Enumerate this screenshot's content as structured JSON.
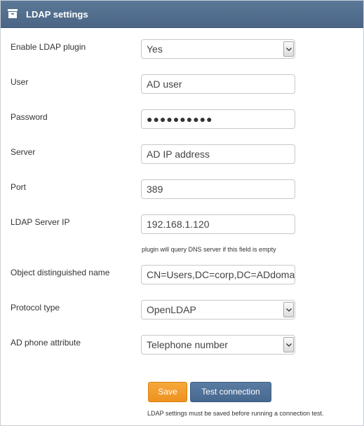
{
  "header": {
    "title": "LDAP settings",
    "icon": "archive-box-icon"
  },
  "form": {
    "enable_label": "Enable LDAP plugin",
    "enable_value": "Yes",
    "user_label": "User",
    "user_value": "AD user",
    "password_label": "Password",
    "password_value": "●●●●●●●●●●",
    "server_label": "Server",
    "server_value": "AD IP address",
    "port_label": "Port",
    "port_value": "389",
    "ldap_ip_label": "LDAP Server IP",
    "ldap_ip_value": "192.168.1.120",
    "ldap_ip_hint": "plugin will query DNS server if this field is empty",
    "dn_label": "Object distinguished name",
    "dn_value": "CN=Users,DC=corp,DC=ADdomain",
    "protocol_label": "Protocol type",
    "protocol_value": "OpenLDAP",
    "phone_attr_label": "AD phone attribute",
    "phone_attr_value": "Telephone number"
  },
  "actions": {
    "save_label": "Save",
    "test_label": "Test connection",
    "note": "LDAP settings must be saved before running a connection test."
  },
  "colors": {
    "header": "#4f6b8b",
    "save_button": "#f29a2c",
    "test_button": "#4f6f96"
  }
}
